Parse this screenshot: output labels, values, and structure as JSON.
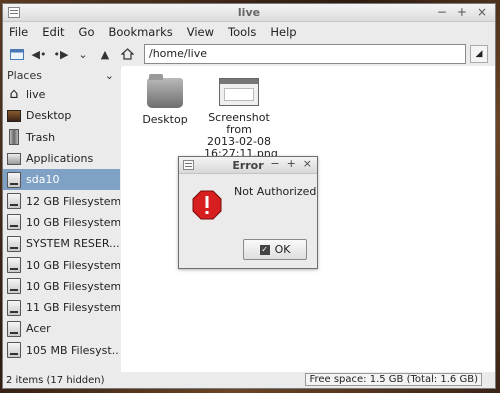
{
  "window": {
    "title": "live",
    "buttons": [
      "−",
      "+",
      "×"
    ]
  },
  "menubar": [
    "File",
    "Edit",
    "Go",
    "Bookmarks",
    "View",
    "Tools",
    "Help"
  ],
  "toolbar": {
    "path": "/home/live"
  },
  "sidebar": {
    "header": "Places",
    "items": [
      {
        "label": "live",
        "icon": "home-icon"
      },
      {
        "label": "Desktop",
        "icon": "desktop-icon"
      },
      {
        "label": "Trash",
        "icon": "trash-icon"
      },
      {
        "label": "Applications",
        "icon": "applications-icon"
      },
      {
        "label": "sda10",
        "icon": "drive-icon",
        "selected": true
      },
      {
        "label": "12 GB Filesystem",
        "icon": "drive-icon"
      },
      {
        "label": "10 GB Filesystem",
        "icon": "drive-icon"
      },
      {
        "label": "SYSTEM RESER...",
        "icon": "drive-icon"
      },
      {
        "label": "10 GB Filesystem",
        "icon": "drive-icon"
      },
      {
        "label": "10 GB Filesystem",
        "icon": "drive-icon"
      },
      {
        "label": "11 GB Filesystem",
        "icon": "drive-icon"
      },
      {
        "label": "Acer",
        "icon": "drive-icon"
      },
      {
        "label": "105 MB Filesyst...",
        "icon": "drive-icon"
      }
    ]
  },
  "files": [
    {
      "name": "Desktop",
      "icon": "folder-icon"
    },
    {
      "name": "Screenshot from 2013-02-08 16:27:11.png",
      "line1": "Screenshot",
      "line2": "from",
      "line3": "2013-02-08",
      "line4": "16:27:11.png",
      "icon": "image-file-icon"
    }
  ],
  "status": {
    "items": "2 items (17 hidden)",
    "free": "Free space: 1.5 GB (Total: 1.6 GB)"
  },
  "dialog": {
    "title": "Error",
    "message": "Not Authorized",
    "ok_label": "OK",
    "buttons": [
      "−",
      "+",
      "×"
    ]
  }
}
